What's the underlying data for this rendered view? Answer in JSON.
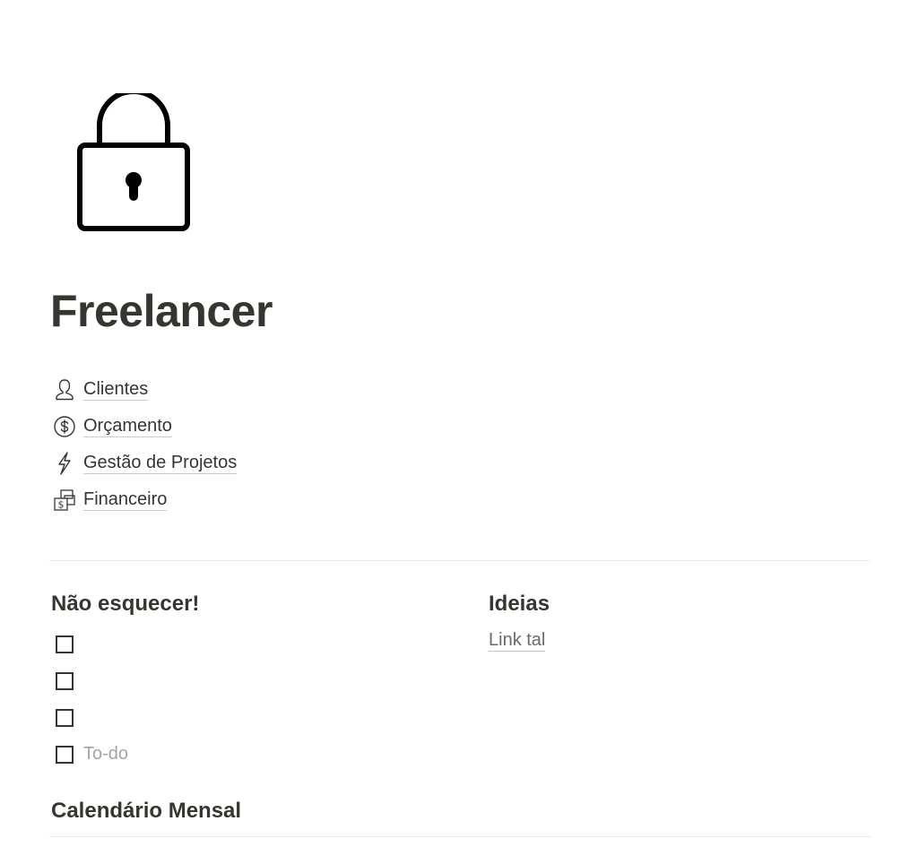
{
  "page": {
    "icon": "lock-icon",
    "title": "Freelancer"
  },
  "links": [
    {
      "label": "Clientes",
      "icon": "person-icon"
    },
    {
      "label": "Orçamento",
      "icon": "dollar-circle-icon"
    },
    {
      "label": "Gestão de Projetos",
      "icon": "lightning-icon"
    },
    {
      "label": "Financeiro",
      "icon": "money-stack-icon"
    }
  ],
  "reminders": {
    "heading": "Não esquecer!",
    "items": [
      {
        "text": "",
        "checked": false
      },
      {
        "text": "",
        "checked": false
      },
      {
        "text": "",
        "checked": false
      },
      {
        "text": "",
        "placeholder": "To-do",
        "checked": false
      }
    ]
  },
  "ideas": {
    "heading": "Ideias",
    "link_label": "Link tal"
  },
  "calendar": {
    "heading": "Calendário Mensal"
  },
  "colors": {
    "text": "#37352f",
    "placeholder": "#a5a4a0",
    "divider": "#e9e9e7"
  }
}
